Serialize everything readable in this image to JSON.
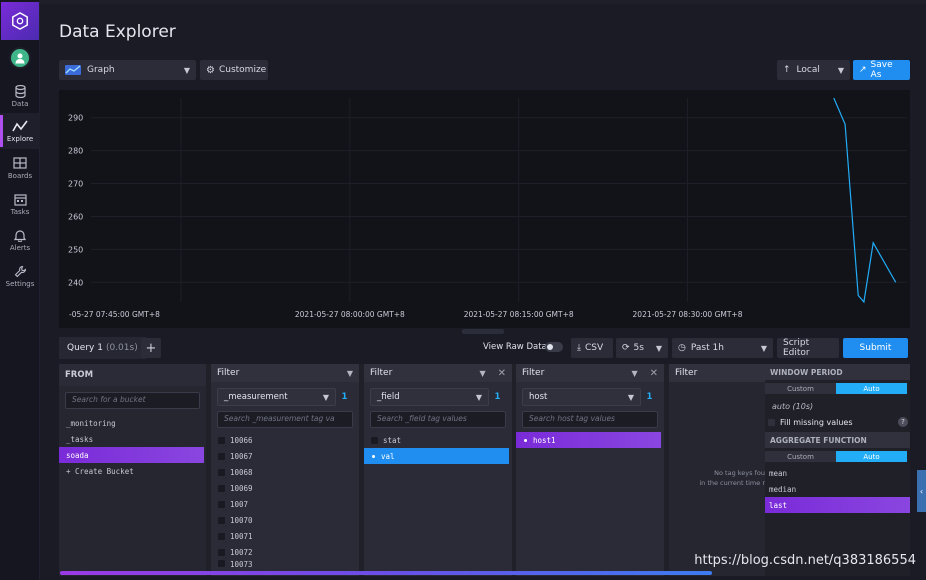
{
  "sidebar": {
    "items": [
      {
        "label": "Data",
        "icon": "database-icon"
      },
      {
        "label": "Explore",
        "icon": "graph-line-icon"
      },
      {
        "label": "Boards",
        "icon": "dashboards-icon"
      },
      {
        "label": "Tasks",
        "icon": "calendar-icon"
      },
      {
        "label": "Alerts",
        "icon": "bell-icon"
      },
      {
        "label": "Settings",
        "icon": "wrench-icon"
      }
    ]
  },
  "header": {
    "title": "Data Explorer",
    "graph_type": "Graph",
    "customize": "Customize",
    "timezone": "Local",
    "save_as": "Save As"
  },
  "chart_data": {
    "type": "line",
    "y_ticks": [
      "290",
      "280",
      "270",
      "260",
      "250",
      "240"
    ],
    "x_ticks": [
      "-05-27 07:45:00 GMT+8",
      "2021-05-27 08:00:00 GMT+8",
      "2021-05-27 08:15:00 GMT+8",
      "2021-05-27 08:30:00 GMT+8"
    ],
    "ylim": [
      234,
      296
    ],
    "series": [
      {
        "color": "#22adf6",
        "x": [
          "08:43:00",
          "08:44:00",
          "08:45:10",
          "08:45:40",
          "08:46:30",
          "08:48:30"
        ],
        "y": [
          296,
          288,
          236,
          233,
          252,
          240
        ]
      }
    ]
  },
  "query_bar": {
    "tab_label": "Query 1",
    "tab_time": "(0.01s)",
    "add": "+",
    "view_raw": "View Raw Data",
    "csv": "CSV",
    "refresh": "5s",
    "range": "Past 1h",
    "script_editor": "Script Editor",
    "submit": "Submit"
  },
  "builder": {
    "from": {
      "title": "FROM",
      "search_placeholder": "Search for a bucket",
      "buckets": [
        "_monitoring",
        "_tasks",
        "soada"
      ],
      "selected": "soada",
      "create": "+ Create Bucket"
    },
    "filter1": {
      "title": "Filter",
      "key": "_measurement",
      "count": "1",
      "search_placeholder": "Search _measurement tag va",
      "values": [
        "10066",
        "10067",
        "10068",
        "10069",
        "1007",
        "10070",
        "10071",
        "10072",
        "10073"
      ]
    },
    "filter2": {
      "title": "Filter",
      "key": "_field",
      "count": "1",
      "search_placeholder": "Search _field tag values",
      "values": [
        "stat",
        "val"
      ],
      "selected": "val"
    },
    "filter3": {
      "title": "Filter",
      "key": "host",
      "count": "1",
      "search_placeholder": "Search host tag values",
      "values": [
        "host1"
      ],
      "selected": "host1"
    },
    "filter4": {
      "title": "Filter",
      "empty_line1": "No tag keys fou",
      "empty_line2": "in the current time r"
    },
    "window": {
      "title": "WINDOW PERIOD",
      "custom": "Custom",
      "auto": "Auto",
      "period": "auto (10s)",
      "fill_missing": "Fill missing values",
      "help": "?",
      "agg_title": "AGGREGATE FUNCTION",
      "functions": [
        "mean",
        "median",
        "last"
      ],
      "selected": "last"
    }
  },
  "watermark": "https://blog.csdn.net/q383186554"
}
